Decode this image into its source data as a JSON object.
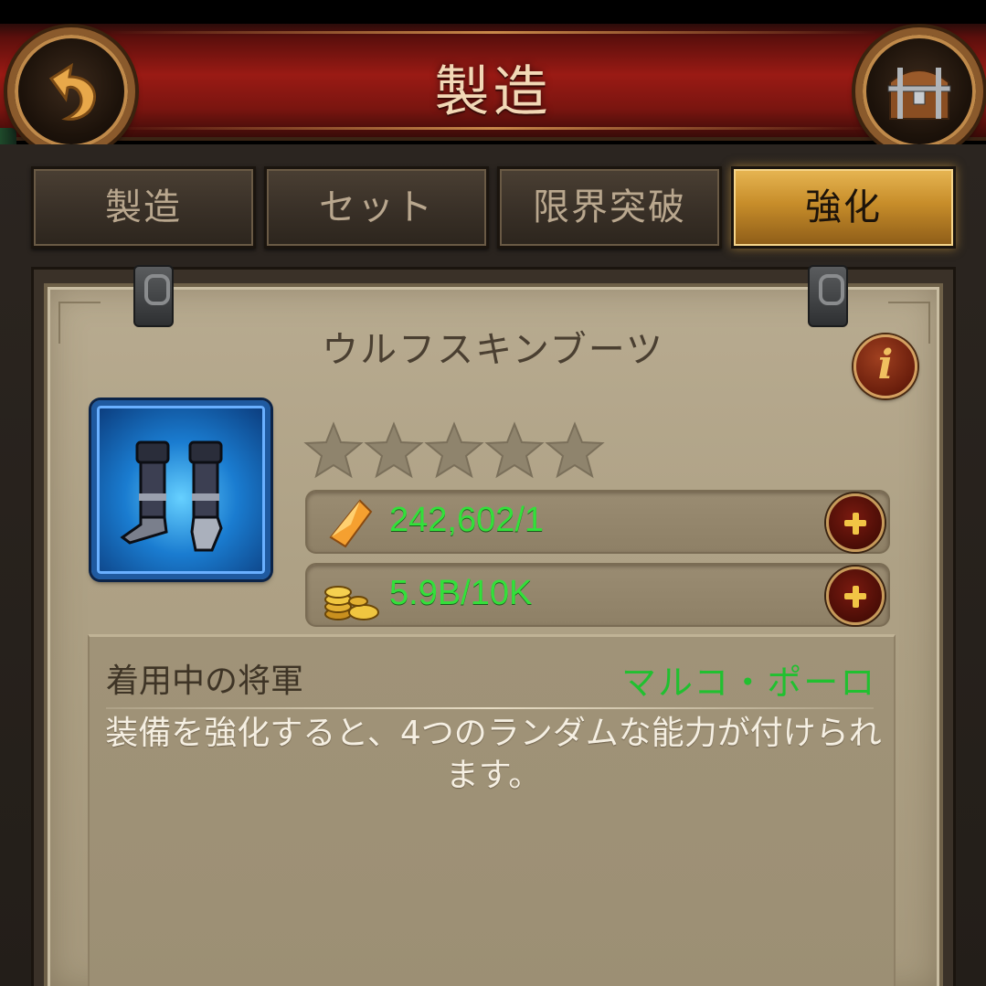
{
  "header": {
    "title": "製造"
  },
  "tabs": [
    {
      "label": "製造",
      "active": false
    },
    {
      "label": "セット",
      "active": false
    },
    {
      "label": "限界突破",
      "active": false
    },
    {
      "label": "強化",
      "active": true
    }
  ],
  "item": {
    "name": "ウルフスキンブーツ",
    "stars_filled": 0,
    "stars_total": 5
  },
  "resources": [
    {
      "icon": "crystal-shard-icon",
      "value": "242,602/1"
    },
    {
      "icon": "gold-coins-icon",
      "value": "5.9B/10K"
    }
  ],
  "equipped": {
    "label": "着用中の将軍",
    "general_name": "マルコ・ポーロ"
  },
  "description": "装備を強化すると、4つのランダムな能力が付けられます。",
  "colors": {
    "header_red": "#9a1a14",
    "active_tab_gold": "#c78d2a",
    "resource_green": "#33e03a",
    "general_green": "#21c030"
  }
}
